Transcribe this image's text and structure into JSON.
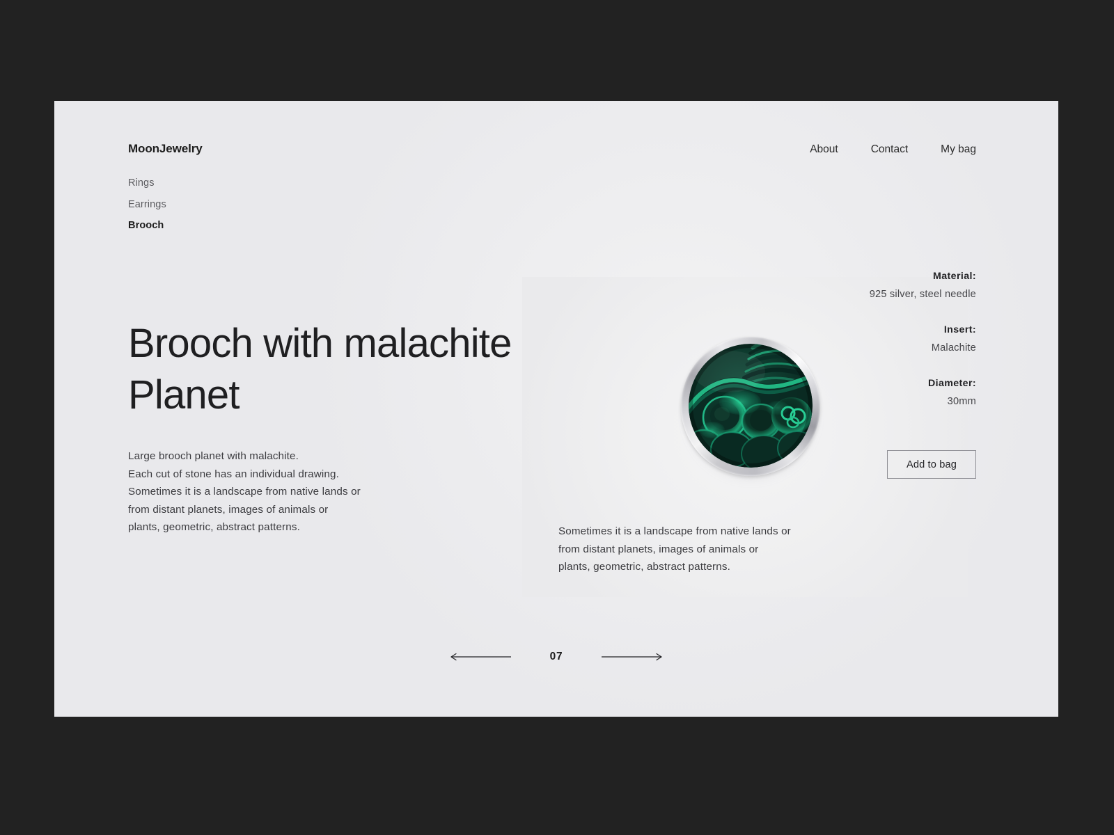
{
  "brand": {
    "logo": "MoonJewelry"
  },
  "top_nav": [
    {
      "label": "About"
    },
    {
      "label": "Contact"
    },
    {
      "label": "My bag"
    }
  ],
  "category_nav": [
    {
      "label": "Rings",
      "active": false
    },
    {
      "label": "Earrings",
      "active": false
    },
    {
      "label": "Brooch",
      "active": true
    }
  ],
  "product": {
    "title": "Brooch with malachite Planet",
    "description_lines": [
      "Large brooch planet with malachite.",
      "Each cut of stone has an individual drawing.",
      "Sometimes it is a landscape from native lands or",
      "from distant planets, images of animals or",
      "plants, geometric, abstract patterns."
    ],
    "photo_caption_lines": [
      "Sometimes it is a landscape from native lands or",
      "from distant planets, images of animals or",
      "plants, geometric, abstract patterns."
    ],
    "image_alt": "round silver brooch with green malachite stone insert"
  },
  "specs": [
    {
      "label": "Material:",
      "value": "925 silver, steel needle"
    },
    {
      "label": "Insert:",
      "value": "Malachite"
    },
    {
      "label": "Diameter:",
      "value": "30mm"
    }
  ],
  "actions": {
    "add_to_bag": "Add to bag"
  },
  "pagination": {
    "current": "07",
    "prev_icon": "arrow-left-icon",
    "next_icon": "arrow-right-icon"
  },
  "colors": {
    "page_background": "#222222",
    "card_background": "#ededef",
    "text_primary": "#1d1d1d",
    "text_secondary": "#3b3b3f",
    "text_muted": "#5c5c60",
    "malachite_dark": "#0b2b24",
    "malachite_mid": "#11614a",
    "malachite_bright": "#16b07a",
    "silver": "#c9c9cd"
  }
}
